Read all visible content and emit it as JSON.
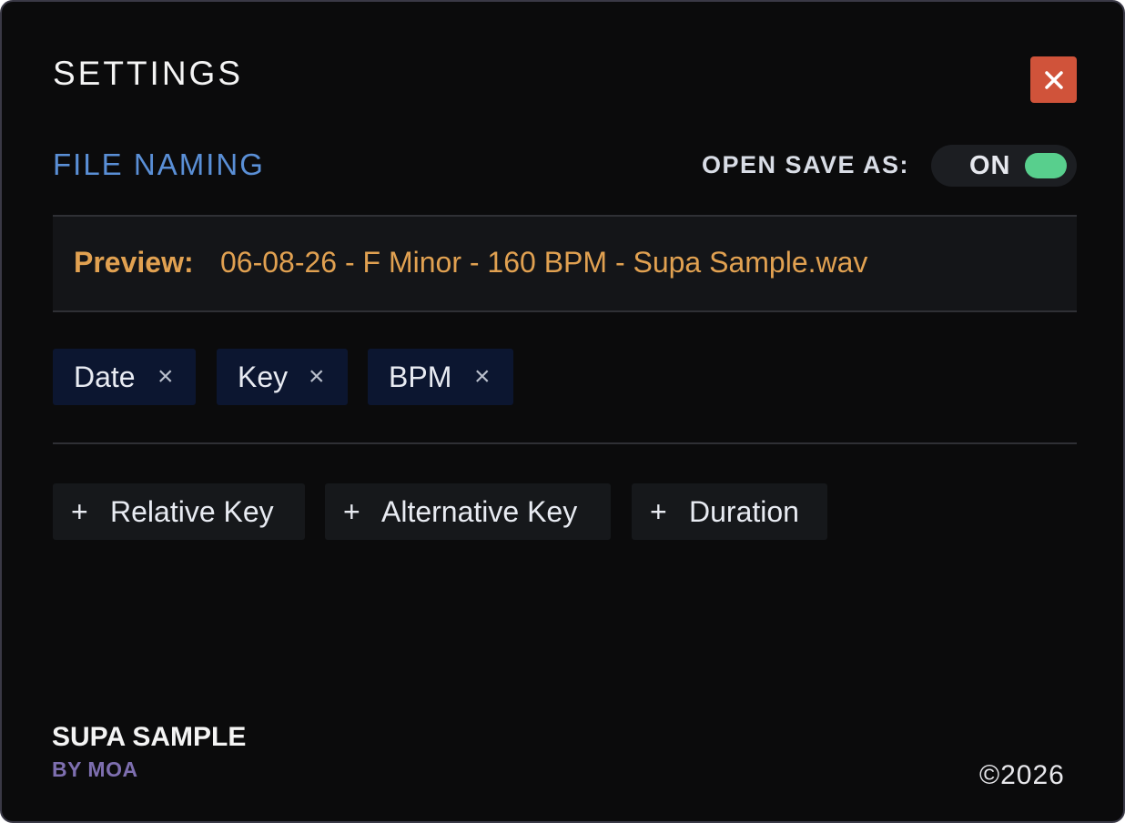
{
  "header": {
    "title": "SETTINGS",
    "close_icon": "close-icon",
    "close_color": "#d0533a"
  },
  "file_naming": {
    "section_label": "FILE NAMING",
    "open_save_as_label": "OPEN SAVE AS:",
    "toggle_state": "ON",
    "toggle_color": "#58cf8d",
    "preview_label": "Preview:",
    "preview_value": "06-08-26 - F Minor - 160 BPM - Supa Sample.wav"
  },
  "active_tags": [
    {
      "label": "Date",
      "remove_icon": "×"
    },
    {
      "label": "Key",
      "remove_icon": "×"
    },
    {
      "label": "BPM",
      "remove_icon": "×"
    }
  ],
  "available_tags": [
    {
      "label": "Relative Key",
      "icon": "+"
    },
    {
      "label": "Alternative Key",
      "icon": "+"
    },
    {
      "label": "Duration",
      "icon": "+"
    }
  ],
  "footer": {
    "brand": "SUPA SAMPLE",
    "brand_sub": "BY MOA",
    "copyright": "©2026"
  },
  "colors": {
    "background": "#0b0b0c",
    "accent_blue": "#5a8fd6",
    "preview_orange": "#e1a151",
    "brand_purple": "#7e6fb0"
  }
}
